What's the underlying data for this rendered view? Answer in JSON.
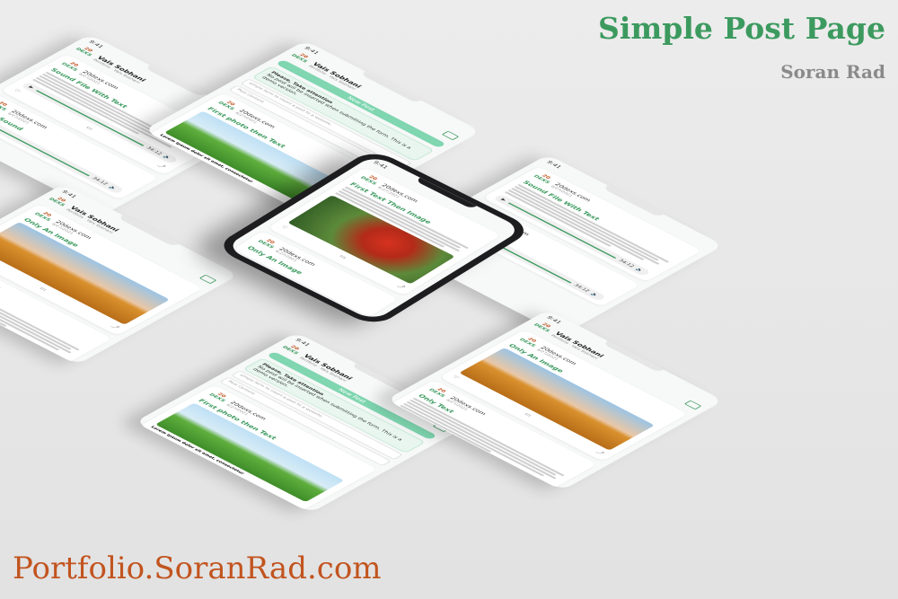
{
  "header": {
    "title": "Simple Post Page",
    "author": "Soran Rad"
  },
  "footer": {
    "url": "Portfolio.SoranRad.com"
  },
  "common": {
    "time": "9:41",
    "profile_name": "Vais Sobhani",
    "profile_subtitle": "Portfolio · Vais Sobhani",
    "site": "20dexs.com",
    "logo_top": "20",
    "logo_bottom": "DEXS",
    "post_date": "6/27/2021",
    "new_post_label": "New Post",
    "notice_title": "Please, Take attention",
    "notice_body": "No post will be inserted when submitting the form. This is a demo version.",
    "simple_form": "simple form to insert a post to a website.",
    "post_content": "Post Content",
    "duration": "34:12",
    "lorem": "Lorem ipsum dolor sit amet, consectetur"
  },
  "titles": {
    "sound_file_with_text": "Sound File With Text",
    "only_sound": "Only Sound",
    "only_image": "Only An Image",
    "only_text": "Only Text",
    "first_text_then_image": "First Text Then Image",
    "first_photo_then_text": "First photo then Text"
  },
  "colors": {
    "accent": "#3c9a5f",
    "author": "#8a8a8a",
    "url": "#c2541f"
  }
}
